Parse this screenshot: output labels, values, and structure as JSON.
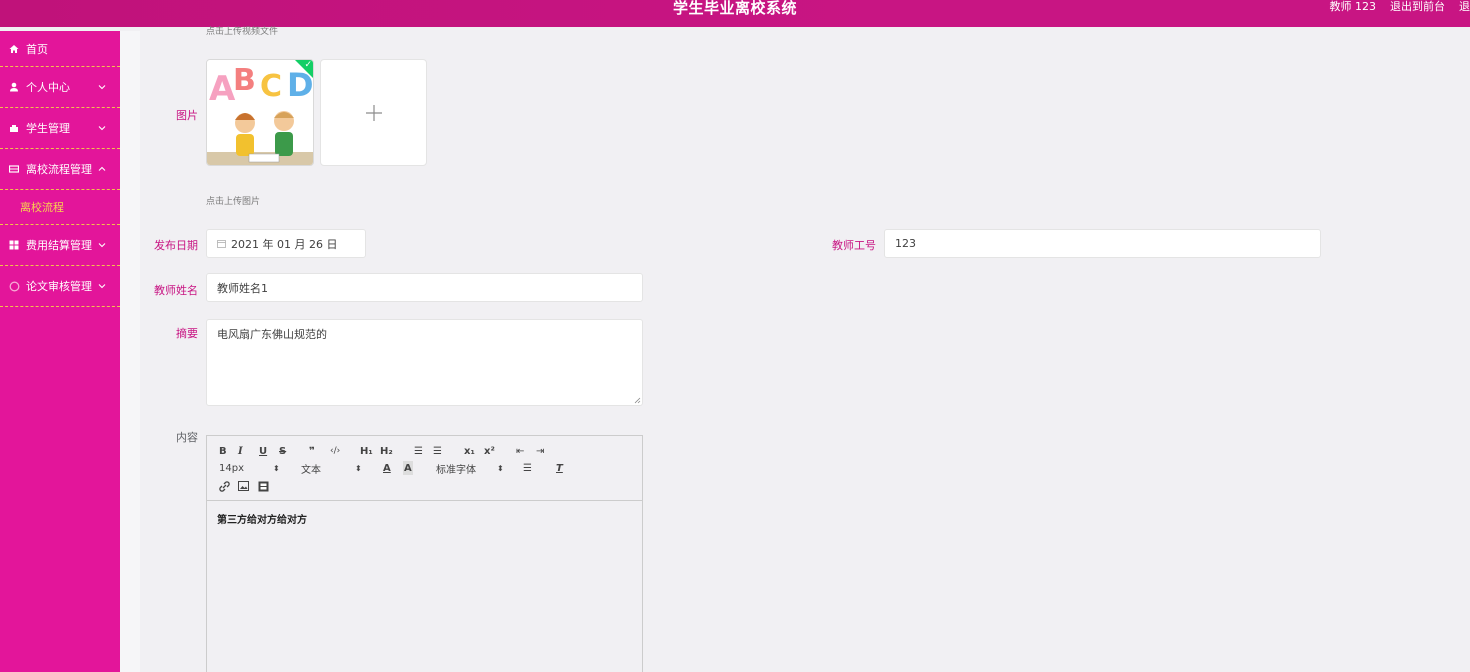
{
  "header": {
    "title": "学生毕业离校系统",
    "user": "教师 123",
    "exit_front": "退出到前台",
    "exit": "退"
  },
  "sidebar": {
    "items": [
      {
        "label": "首页",
        "icon": "home-icon"
      },
      {
        "label": "个人中心",
        "icon": "user-icon"
      },
      {
        "label": "学生管理",
        "icon": "student-icon"
      },
      {
        "label": "离校流程管理",
        "icon": "flow-icon"
      },
      {
        "label": "离校流程",
        "icon": ""
      },
      {
        "label": "费用结算管理",
        "icon": "grid-icon"
      },
      {
        "label": "论文审核管理",
        "icon": "circle-icon"
      }
    ]
  },
  "form": {
    "top_tip": "点击上传视频文件",
    "image_label": "图片",
    "image_tip": "点击上传图片",
    "date_label": "发布日期",
    "date_value": "2021 年 01 月 26 日",
    "teacher_no_label": "教师工号",
    "teacher_no_value": "123",
    "teacher_name_label": "教师姓名",
    "teacher_name_value": "教师姓名1",
    "summary_label": "摘要",
    "summary_value": "电风扇广东佛山规范的",
    "content_label": "内容",
    "content_value": "第三方给对方给对方"
  },
  "editor": {
    "font_size": "14px",
    "block_type": "文本",
    "font_family": "标准字体"
  },
  "colors": {
    "header_bg": "#c81583",
    "sidebar_bg": "#e3159a",
    "accent_text": "#c81583",
    "submenu_text": "#f7d44f",
    "divider": "#f3c34a",
    "success": "#13ce66"
  }
}
